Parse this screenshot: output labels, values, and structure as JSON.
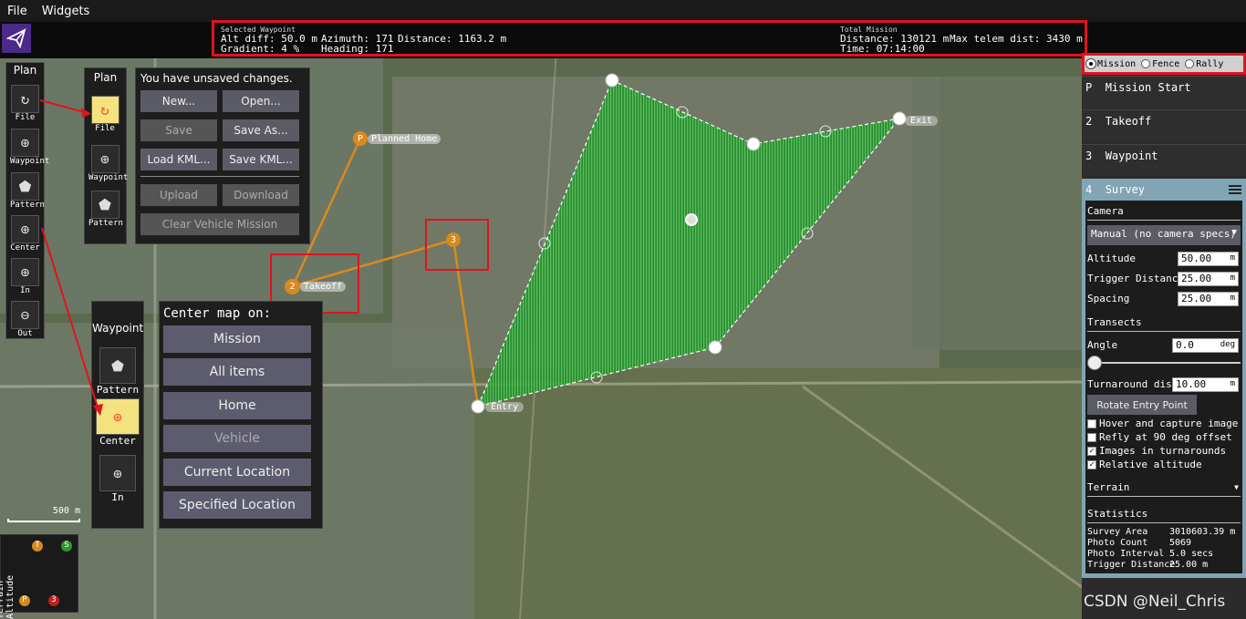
{
  "menu": {
    "file": "File",
    "widgets": "Widgets"
  },
  "selected_waypoint": {
    "title": "Selected Waypoint",
    "alt_diff": "Alt diff: 50.0 m",
    "gradient": "Gradient: 4 %",
    "azimuth": "Azimuth: 171",
    "heading": "Heading: 171",
    "distance": "Distance: 1163.2 m"
  },
  "total_mission": {
    "title": "Total Mission",
    "distance": "Distance: 130121 m",
    "time": "Time:     07:14:00",
    "max_telem": "Max telem dist: 3430 m"
  },
  "toolstrip": {
    "plan": "Plan",
    "file": "File",
    "waypoint": "Waypoint",
    "pattern": "Pattern",
    "center": "Center",
    "in": "In",
    "out": "Out"
  },
  "file_panel": {
    "plan": "Plan",
    "file": "File",
    "waypoint": "Waypoint",
    "pattern": "Pattern",
    "unsaved": "You have unsaved changes.",
    "new": "New...",
    "open": "Open...",
    "save": "Save",
    "save_as": "Save As...",
    "load_kml": "Load KML...",
    "save_kml": "Save KML...",
    "upload": "Upload",
    "download": "Download",
    "clear": "Clear Vehicle Mission"
  },
  "center_panel": {
    "title": "Center map on:",
    "waypoint": "Waypoint",
    "pattern": "Pattern",
    "center": "Center",
    "in": "In",
    "options": [
      "Mission",
      "All items",
      "Home",
      "Vehicle",
      "Current Location",
      "Specified Location"
    ]
  },
  "map": {
    "planned_home": "Planned Home",
    "takeoff": "Takeoff",
    "entry": "Entry",
    "exit": "Exit",
    "home_marker": "P",
    "takeoff_marker": "2",
    "wp_marker": "3",
    "scale": "500 m"
  },
  "layers": {
    "mission": "Mission",
    "fence": "Fence",
    "rally": "Rally"
  },
  "items": [
    {
      "num": "P",
      "label": "Mission Start"
    },
    {
      "num": "2",
      "label": "Takeoff"
    },
    {
      "num": "3",
      "label": "Waypoint"
    },
    {
      "num": "4",
      "label": "Survey"
    }
  ],
  "survey": {
    "camera": "Camera",
    "camera_select": "Manual (no camera specs)",
    "altitude_label": "Altitude",
    "altitude": "50.00",
    "trigger_label": "Trigger Distance",
    "trigger": "25.00",
    "spacing_label": "Spacing",
    "spacing": "25.00",
    "unit_m": "m",
    "unit_deg": "deg",
    "transects": "Transects",
    "angle_label": "Angle",
    "angle": "0.0",
    "turnaround_label": "Turnaround dist",
    "turnaround": "10.00",
    "rotate": "Rotate Entry Point",
    "hover": "Hover and capture image",
    "refly": "Refly at 90 deg offset",
    "images_turn": "Images in turnarounds",
    "relative_alt": "Relative altitude",
    "terrain": "Terrain",
    "statistics": "Statistics",
    "area_label": "Survey Area",
    "area": "3010603.39 m",
    "photo_count_label": "Photo Count",
    "photo_count": "5069",
    "photo_interval_label": "Photo Interval",
    "photo_interval": "5.0 secs",
    "trig_label": "Trigger Distance",
    "trig": "25.00 m",
    "checks": {
      "hover": false,
      "refly": false,
      "images_turn": true,
      "relative_alt": true
    }
  },
  "altitude_widget": {
    "label": "Terrain Altitude",
    "t": "T",
    "s": "S",
    "p": "P",
    "three": "3"
  },
  "watermark": "CSDN @Neil_Chris",
  "colors": {
    "accent_red": "#e0141e",
    "survey_green": "#2e8b2e",
    "path_orange": "#d98a1e",
    "panel_blue": "#82a5b5"
  }
}
